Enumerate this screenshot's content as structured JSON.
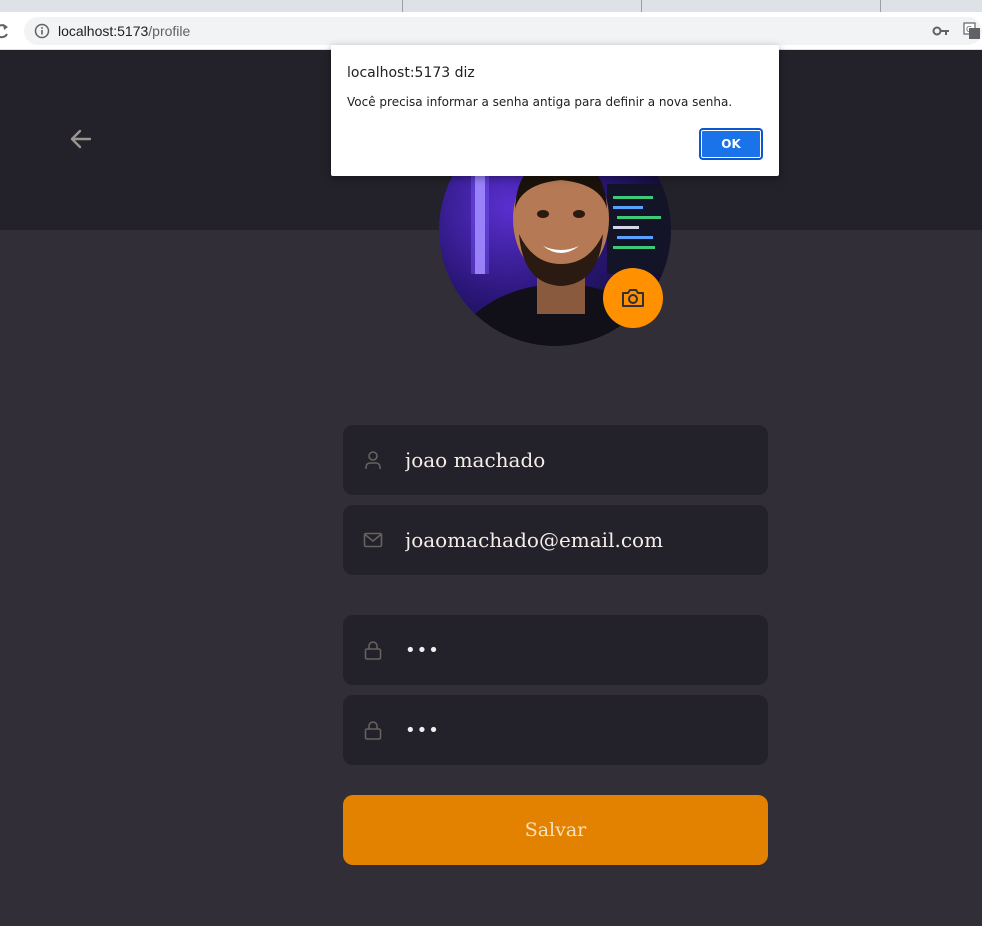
{
  "browser": {
    "url_host": "localhost:5173",
    "url_path": "/profile"
  },
  "dialog": {
    "title": "localhost:5173 diz",
    "message": "Você precisa informar a senha antiga para definir a nova senha.",
    "ok_label": "OK"
  },
  "profile": {
    "name": "joao machado",
    "email": "joaomachado@email.com",
    "old_password": "123",
    "new_password": "123",
    "save_label": "Salvar"
  },
  "colors": {
    "background": "#312e38",
    "header": "#232129",
    "accent": "#ff9000",
    "button": "#e38200",
    "text": "#f4ede8",
    "icon": "#666360"
  },
  "icons": [
    "reload-icon",
    "info-icon",
    "key-icon",
    "translate-icon",
    "arrow-left-icon",
    "camera-icon",
    "user-icon",
    "mail-icon",
    "lock-icon"
  ]
}
